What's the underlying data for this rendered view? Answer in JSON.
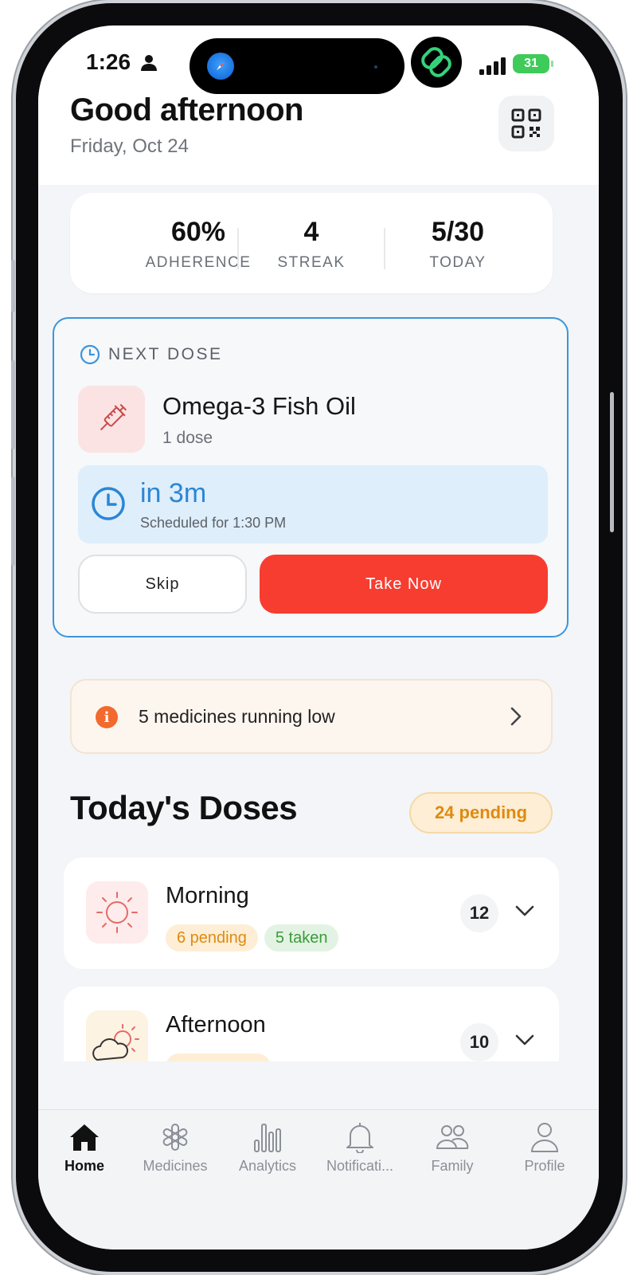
{
  "status_bar": {
    "time": "1:26",
    "battery": "31"
  },
  "header": {
    "greeting": "Good afternoon",
    "date": "Friday, Oct 24"
  },
  "stats": [
    {
      "value": "60%",
      "label": "ADHERENCE"
    },
    {
      "value": "4",
      "label": "STREAK"
    },
    {
      "value": "5/30",
      "label": "TODAY"
    }
  ],
  "next_dose": {
    "heading": "NEXT DOSE",
    "medicine": "Omega-3 Fish Oil",
    "amount": "1 dose",
    "countdown": "in 3m",
    "scheduled": "Scheduled for 1:30 PM",
    "skip_label": "Skip",
    "take_label": "Take Now"
  },
  "alert": {
    "text": "5 medicines running low"
  },
  "todays_doses": {
    "title": "Today's Doses",
    "pending_badge": "24 pending",
    "periods": [
      {
        "name": "Morning",
        "pending": "6 pending",
        "taken": "5 taken",
        "count": "12"
      },
      {
        "name": "Afternoon",
        "count": "10"
      }
    ]
  },
  "tabs": [
    {
      "label": "Home",
      "icon": "home-icon",
      "active": true
    },
    {
      "label": "Medicines",
      "icon": "medicines-icon"
    },
    {
      "label": "Analytics",
      "icon": "analytics-icon"
    },
    {
      "label": "Notificati...",
      "icon": "bell-icon"
    },
    {
      "label": "Family",
      "icon": "family-icon"
    },
    {
      "label": "Profile",
      "icon": "profile-icon"
    }
  ],
  "colors": {
    "accent_red": "#f73d30",
    "accent_blue": "#3b95db",
    "warning_orange": "#f26a2e",
    "pending_amber": "#e08a0f",
    "taken_green": "#3b9a3b"
  }
}
